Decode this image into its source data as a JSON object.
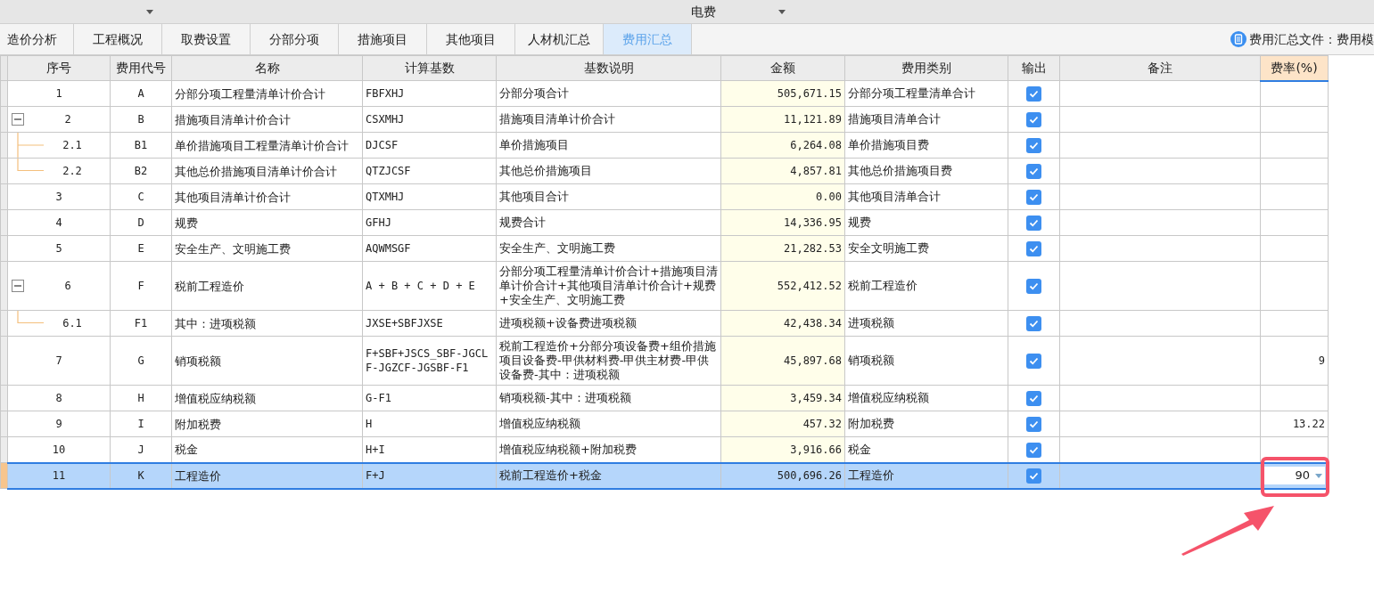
{
  "title_bar": {
    "title": "电费"
  },
  "tabs": [
    {
      "label": "造价分析",
      "selected": false
    },
    {
      "label": "工程概况",
      "selected": false
    },
    {
      "label": "取费设置",
      "selected": false
    },
    {
      "label": "分部分项",
      "selected": false
    },
    {
      "label": "措施项目",
      "selected": false
    },
    {
      "label": "其他项目",
      "selected": false
    },
    {
      "label": "人材机汇总",
      "selected": false
    },
    {
      "label": "费用汇总",
      "selected": true
    }
  ],
  "template_file": "费用汇总文件：费用模",
  "table": {
    "columns": [
      "序号",
      "费用代号",
      "名称",
      "计算基数",
      "基数说明",
      "金额",
      "费用类别",
      "输出",
      "备注",
      "费率(%)"
    ],
    "rows": [
      {
        "no": "1",
        "code": "A",
        "name": "分部分项工程量清单计价合计",
        "base": "FBFXHJ",
        "desc": "分部分项合计",
        "amount": "505,671.15",
        "category": "分部分项工程量清单合计",
        "output": true,
        "selected": false
      },
      {
        "no": "2",
        "code": "B",
        "name": "措施项目清单计价合计",
        "base": "CSXMHJ",
        "desc": "措施项目清单计价合计",
        "amount": "11,121.89",
        "category": "措施项目清单合计",
        "output": true,
        "selected": false,
        "expanded": true,
        "children": [
          {
            "no": "2.1",
            "code": "B1",
            "name": "单价措施项目工程量清单计价合计",
            "base": "DJCSF",
            "desc": "单价措施项目",
            "amount": "6,264.08",
            "category": "单价措施项目费",
            "output": true,
            "selected": false
          },
          {
            "no": "2.2",
            "code": "B2",
            "name": "其他总价措施项目清单计价合计",
            "base": "QTZJCSF",
            "desc": "其他总价措施项目",
            "amount": "4,857.81",
            "category": "其他总价措施项目费",
            "output": true,
            "selected": false
          }
        ]
      },
      {
        "no": "3",
        "code": "C",
        "name": "其他项目清单计价合计",
        "base": "QTXMHJ",
        "desc": "其他项目合计",
        "amount": "0.00",
        "category": "其他项目清单合计",
        "output": true,
        "selected": false
      },
      {
        "no": "4",
        "code": "D",
        "name": "规费",
        "base": "GFHJ",
        "desc": "规费合计",
        "amount": "14,336.95",
        "category": "规费",
        "output": true,
        "selected": false
      },
      {
        "no": "5",
        "code": "E",
        "name": "安全生产、文明施工费",
        "base": "AQWMSGF",
        "desc": "安全生产、文明施工费",
        "amount": "21,282.53",
        "category": "安全文明施工费",
        "output": true,
        "selected": false
      },
      {
        "no": "6",
        "code": "F",
        "name": "税前工程造价",
        "base": "A + B + C + D + E",
        "desc": "分部分项工程量清单计价合计+措施项目清单计价合计+其他项目清单计价合计+规费+安全生产、文明施工费",
        "amount": "552,412.52",
        "category": "税前工程造价",
        "output": true,
        "selected": false,
        "expanded": true,
        "children": [
          {
            "no": "6.1",
            "code": "F1",
            "name": "其中：进项税额",
            "base": "JXSE+SBFJXSE",
            "desc": "进项税额+设备费进项税额",
            "amount": "42,438.34",
            "category": "进项税额",
            "output": true,
            "selected": false
          }
        ]
      },
      {
        "no": "7",
        "code": "G",
        "name": "销项税额",
        "base": "F+SBF+JSCS_SBF-JGCLF-JGZCF-JGSBF-F1",
        "desc": "税前工程造价+分部分项设备费+组价措施项目设备费-甲供材料费-甲供主材费-甲供设备费-其中：进项税额",
        "amount": "45,897.68",
        "category": "销项税额",
        "output": true,
        "rate": "9",
        "selected": false
      },
      {
        "no": "8",
        "code": "H",
        "name": "增值税应纳税额",
        "base": "G-F1",
        "desc": "销项税额-其中：进项税额",
        "amount": "3,459.34",
        "category": "增值税应纳税额",
        "output": true,
        "selected": false
      },
      {
        "no": "9",
        "code": "I",
        "name": "附加税费",
        "base": "H",
        "desc": "增值税应纳税额",
        "amount": "457.32",
        "category": "附加税费",
        "output": true,
        "rate": "13.22",
        "selected": false
      },
      {
        "no": "10",
        "code": "J",
        "name": "税金",
        "base": "H+I",
        "desc": "增值税应纳税额+附加税费",
        "amount": "3,916.66",
        "category": "税金",
        "output": true,
        "selected": false
      },
      {
        "no": "11",
        "code": "K",
        "name": "工程造价",
        "base": "F+J",
        "desc": "税前工程造价+税金",
        "amount": "500,696.26",
        "category": "工程造价",
        "output": true,
        "rate": "90",
        "selected": true
      }
    ]
  }
}
